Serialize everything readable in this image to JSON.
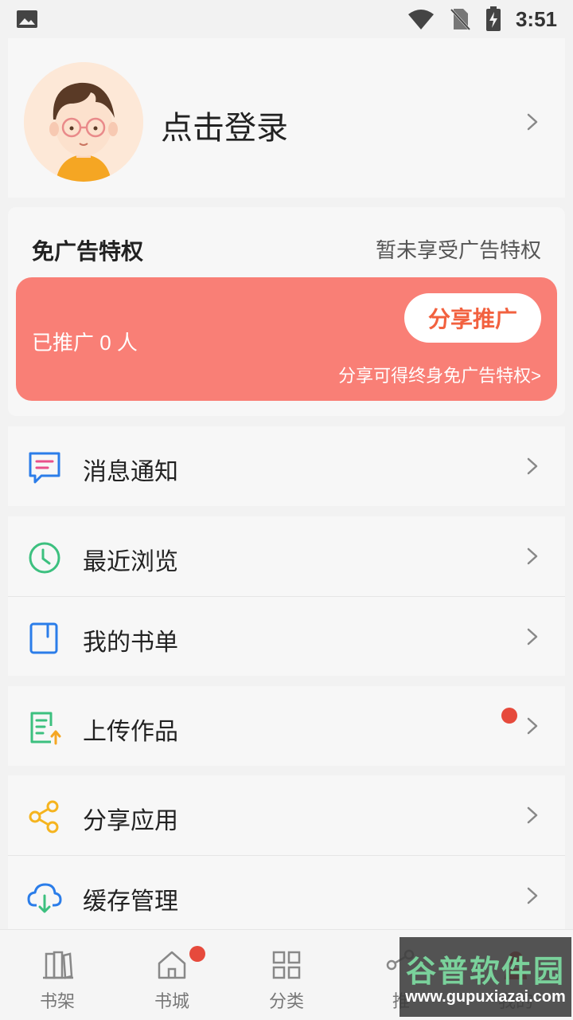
{
  "status_bar": {
    "time": "3:51",
    "icons": [
      "image-icon",
      "wifi-icon",
      "no-sim-icon",
      "battery-charging-icon"
    ]
  },
  "profile": {
    "login_text": "点击登录",
    "avatar_icon": "user-avatar-icon"
  },
  "ad_privilege": {
    "title": "免广告特权",
    "status": "暂未享受广告特权",
    "promoted_text": "已推广 0 人",
    "share_button": "分享推广",
    "share_hint": "分享可得终身免广告特权>",
    "banner_color": "#f97f76",
    "button_text_color": "#f2613f"
  },
  "menu": [
    {
      "label": "消息通知",
      "icon": "message-icon",
      "color": "#2b7de9"
    },
    {
      "label": "最近浏览",
      "icon": "clock-icon",
      "color": "#3cc07f"
    },
    {
      "label": "我的书单",
      "icon": "book-icon",
      "color": "#2b7de9"
    },
    {
      "label": "上传作品",
      "icon": "upload-doc-icon",
      "color": "#3cc07f",
      "badge": true
    },
    {
      "label": "分享应用",
      "icon": "share-icon",
      "color": "#f5b41f"
    },
    {
      "label": "缓存管理",
      "icon": "cloud-download-icon",
      "color": "#2b7de9"
    }
  ],
  "tabs": [
    {
      "label": "书架",
      "icon": "bookshelf-icon"
    },
    {
      "label": "书城",
      "icon": "home-icon",
      "badge": true
    },
    {
      "label": "分类",
      "icon": "grid-icon"
    },
    {
      "label": "推",
      "icon": "share-icon"
    },
    {
      "label": "我的",
      "icon": "profile-icon"
    }
  ],
  "watermark": {
    "main": "谷普软件园",
    "sub": "www.gupuxiazai.com"
  }
}
